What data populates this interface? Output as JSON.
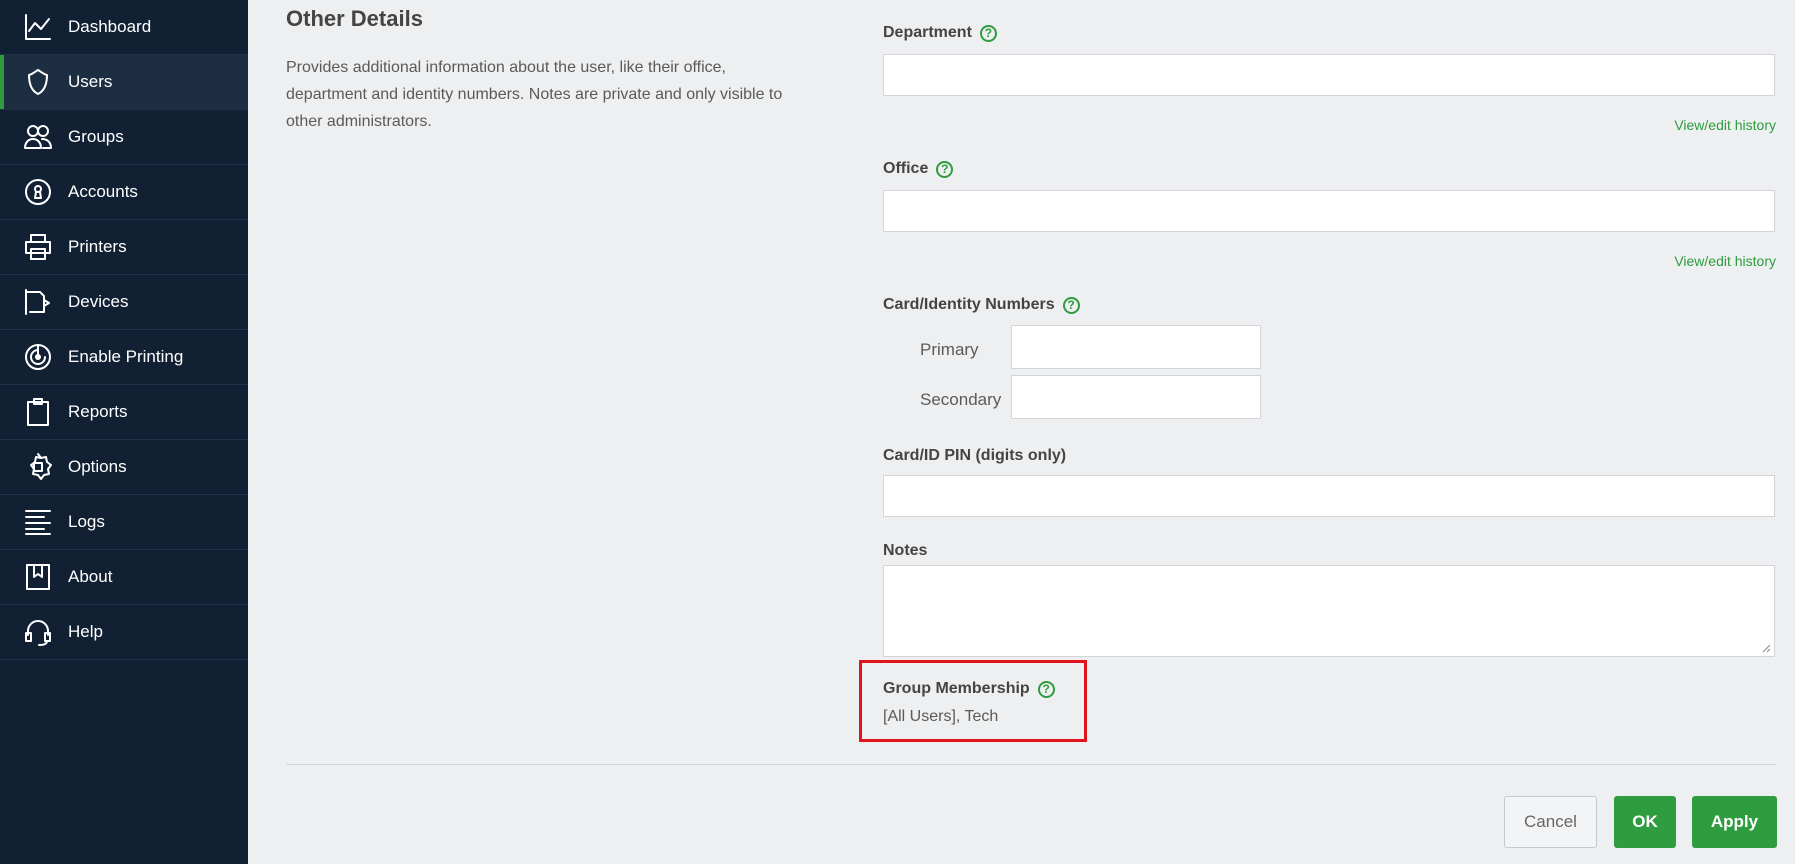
{
  "sidebar": {
    "items": [
      {
        "label": "Dashboard",
        "icon": "chart-line-icon"
      },
      {
        "label": "Users",
        "icon": "user-shield-icon",
        "active": true
      },
      {
        "label": "Groups",
        "icon": "users-group-icon"
      },
      {
        "label": "Accounts",
        "icon": "keyhole-icon"
      },
      {
        "label": "Printers",
        "icon": "printer-icon"
      },
      {
        "label": "Devices",
        "icon": "device-icon"
      },
      {
        "label": "Enable Printing",
        "icon": "target-icon"
      },
      {
        "label": "Reports",
        "icon": "clipboard-icon"
      },
      {
        "label": "Options",
        "icon": "gear-icon"
      },
      {
        "label": "Logs",
        "icon": "lines-icon"
      },
      {
        "label": "About",
        "icon": "bookmark-icon"
      },
      {
        "label": "Help",
        "icon": "headset-icon"
      }
    ]
  },
  "section": {
    "title": "Other Details",
    "description": "Provides additional information about the user, like their office, department and identity numbers. Notes are private and only visible to other administrators."
  },
  "fields": {
    "department": {
      "label": "Department",
      "value": "",
      "history_link": "View/edit history"
    },
    "office": {
      "label": "Office",
      "value": "",
      "history_link": "View/edit history"
    },
    "card_numbers": {
      "label": "Card/Identity Numbers",
      "primary_label": "Primary",
      "secondary_label": "Secondary"
    },
    "card_pin": {
      "label": "Card/ID PIN (digits only)"
    },
    "notes": {
      "label": "Notes"
    },
    "group_membership": {
      "label": "Group Membership",
      "value": "[All Users], Tech"
    }
  },
  "help_glyph": "?",
  "buttons": {
    "cancel": "Cancel",
    "ok": "OK",
    "apply": "Apply"
  },
  "colors": {
    "sidebar_bg": "#112033",
    "accent": "#2e9c3f",
    "highlight": "#e0141d"
  }
}
